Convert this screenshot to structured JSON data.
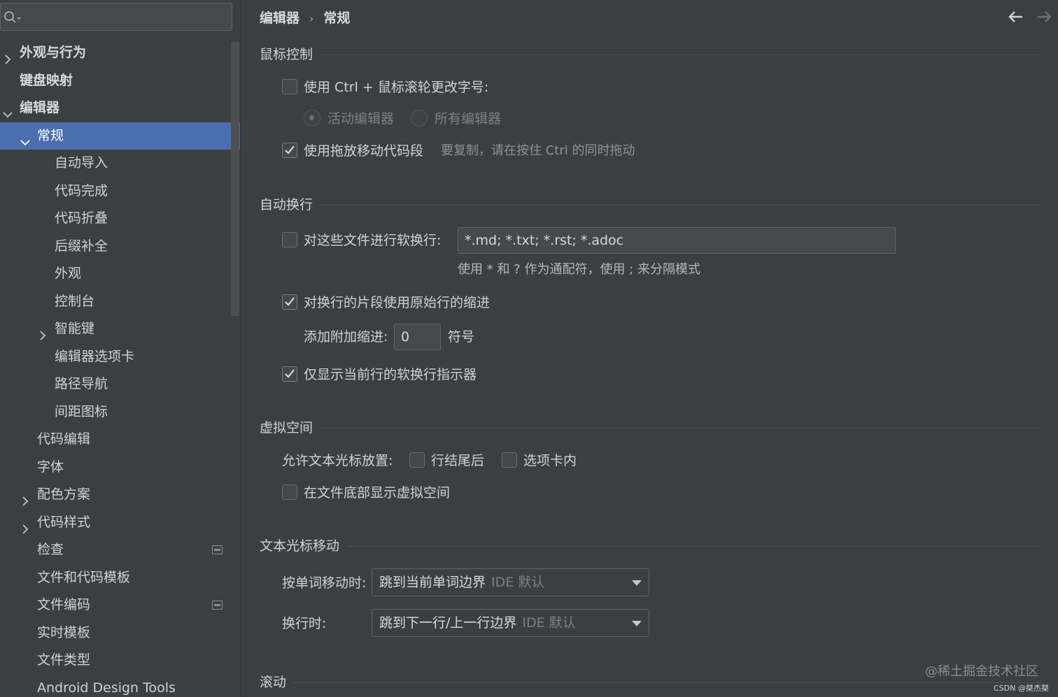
{
  "search": {
    "placeholder": ""
  },
  "sidebar": {
    "items": [
      {
        "label": "外观与行为",
        "arrow": "right",
        "indent": 0,
        "bold": true
      },
      {
        "label": "键盘映射",
        "arrow": "",
        "indent": 0,
        "bold": true
      },
      {
        "label": "编辑器",
        "arrow": "down",
        "indent": 0,
        "bold": true
      },
      {
        "label": "常规",
        "arrow": "down",
        "indent": 1,
        "selected": true
      },
      {
        "label": "自动导入",
        "arrow": "",
        "indent": 2
      },
      {
        "label": "代码完成",
        "arrow": "",
        "indent": 2
      },
      {
        "label": "代码折叠",
        "arrow": "",
        "indent": 2
      },
      {
        "label": "后缀补全",
        "arrow": "",
        "indent": 2
      },
      {
        "label": "外观",
        "arrow": "",
        "indent": 2
      },
      {
        "label": "控制台",
        "arrow": "",
        "indent": 2
      },
      {
        "label": "智能键",
        "arrow": "right",
        "indent": 2
      },
      {
        "label": "编辑器选项卡",
        "arrow": "",
        "indent": 2
      },
      {
        "label": "路径导航",
        "arrow": "",
        "indent": 2
      },
      {
        "label": "间距图标",
        "arrow": "",
        "indent": 2
      },
      {
        "label": "代码编辑",
        "arrow": "",
        "indent": 1
      },
      {
        "label": "字体",
        "arrow": "",
        "indent": 1
      },
      {
        "label": "配色方案",
        "arrow": "right",
        "indent": 1
      },
      {
        "label": "代码样式",
        "arrow": "right",
        "indent": 1
      },
      {
        "label": "检查",
        "arrow": "",
        "indent": 1,
        "badge": true
      },
      {
        "label": "文件和代码模板",
        "arrow": "",
        "indent": 1
      },
      {
        "label": "文件编码",
        "arrow": "",
        "indent": 1,
        "badge": true
      },
      {
        "label": "实时模板",
        "arrow": "",
        "indent": 1
      },
      {
        "label": "文件类型",
        "arrow": "",
        "indent": 1
      },
      {
        "label": "Android Design Tools",
        "arrow": "",
        "indent": 1
      }
    ]
  },
  "breadcrumb": {
    "parent": "编辑器",
    "separator": "›",
    "current": "常规"
  },
  "sections": {
    "mouse": {
      "title": "鼠标控制",
      "ctrl_wheel": {
        "label": "使用 Ctrl + 鼠标滚轮更改字号:",
        "checked": false
      },
      "radio_active": {
        "label": "活动编辑器",
        "selected": true
      },
      "radio_all": {
        "label": "所有编辑器",
        "selected": false
      },
      "dnd": {
        "label": "使用拖放移动代码段",
        "checked": true
      },
      "dnd_hint": "要复制，请在按住 Ctrl 的同时拖动"
    },
    "wrap": {
      "title": "自动换行",
      "soft_wrap": {
        "label": "对这些文件进行软换行:",
        "checked": false
      },
      "soft_wrap_value": "*.md; *.txt; *.rst; *.adoc",
      "soft_wrap_hint": "使用 * 和 ? 作为通配符，使用 ; 来分隔模式",
      "indent_wrapped": {
        "label": "对换行的片段使用原始行的缩进",
        "checked": true
      },
      "extra_indent_label": "添加附加缩进:",
      "extra_indent_value": "0",
      "extra_indent_unit": "符号",
      "current_line_only": {
        "label": "仅显示当前行的软换行指示器",
        "checked": true
      }
    },
    "virtual": {
      "title": "虚拟空间",
      "caret_label": "允许文本光标放置:",
      "after_eol": {
        "label": "行结尾后",
        "checked": false
      },
      "inside_tabs": {
        "label": "选项卡内",
        "checked": false
      },
      "show_bottom": {
        "label": "在文件底部显示虚拟空间",
        "checked": false
      }
    },
    "caret": {
      "title": "文本光标移动",
      "word_label": "按单词移动时:",
      "word_value": "跳到当前单词边界",
      "word_default": "IDE 默认",
      "line_label": "换行时:",
      "line_value": "跳到下一行/上一行边界",
      "line_default": "IDE 默认"
    },
    "scroll": {
      "title": "滚动"
    }
  },
  "watermark": {
    "main": "@稀土掘金技术社区",
    "small": "CSDN @桀杰桀"
  },
  "colors": {
    "background": "#3c3f41",
    "selection": "#4b6eaf",
    "text": "#cfd3d6",
    "hint": "#8f9294"
  }
}
